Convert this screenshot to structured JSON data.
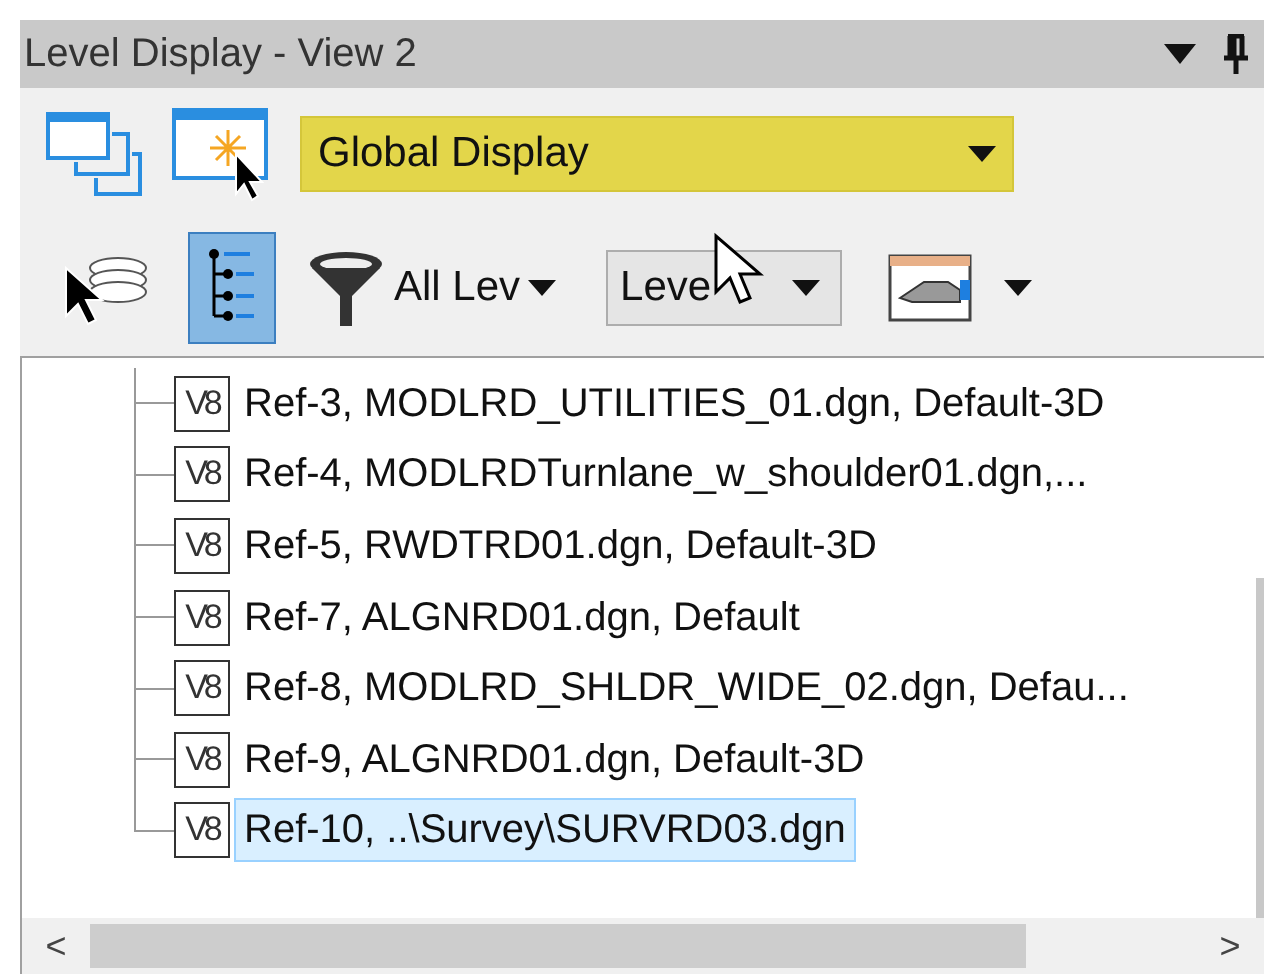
{
  "window": {
    "title": "Level Display - View 2"
  },
  "display_mode": {
    "value": "Global Display"
  },
  "toolbar": [
    {
      "kind": "select",
      "selected": false
    },
    {
      "kind": "tree",
      "selected": true
    },
    {
      "kind": "filter",
      "label": "All Lev",
      "selected": false
    },
    {
      "kind": "dropdown",
      "label": "Leve",
      "selected": false
    },
    {
      "kind": "icon-dropdown",
      "selected": false
    }
  ],
  "tree": [
    {
      "badge": "V8",
      "label": "Ref-3, MODLRD_UTILITIES_01.dgn, Default-3D",
      "selected": false
    },
    {
      "badge": "V8",
      "label": "Ref-4, MODLRDTurnlane_w_shoulder01.dgn,...",
      "selected": false
    },
    {
      "badge": "V8",
      "label": "Ref-5, RWDTRD01.dgn, Default-3D",
      "selected": false
    },
    {
      "badge": "V8",
      "label": "Ref-7, ALGNRD01.dgn, Default",
      "selected": false
    },
    {
      "badge": "V8",
      "label": "Ref-8, MODLRD_SHLDR_WIDE_02.dgn, Defau...",
      "selected": false
    },
    {
      "badge": "V8",
      "label": "Ref-9, ALGNRD01.dgn, Default-3D",
      "selected": false
    },
    {
      "badge": "V8",
      "label": "Ref-10, ..\\Survey\\SURVRD03.dgn",
      "selected": true
    }
  ],
  "horizontal_scrollbar": {
    "left": "<",
    "right": ">"
  }
}
